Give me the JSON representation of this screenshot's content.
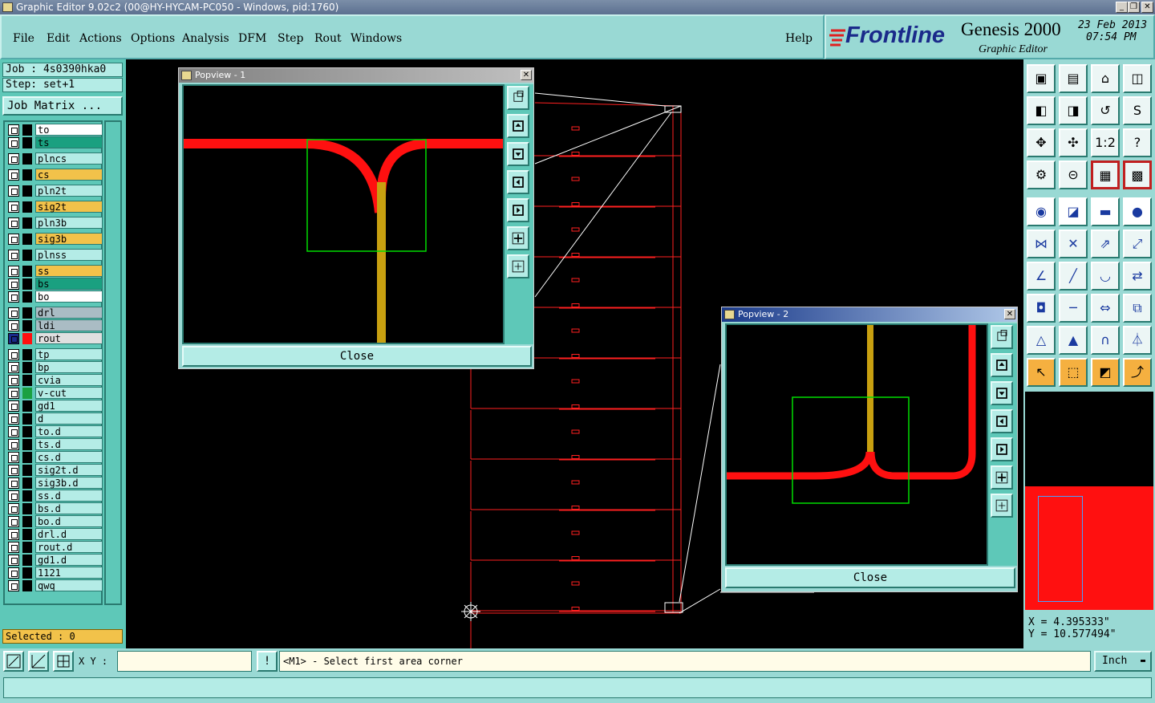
{
  "window": {
    "title": "Graphic Editor 9.02c2 (00@HY-HYCAM-PC050 - Windows, pid:1760)",
    "btn_min": "_",
    "btn_max": "❐",
    "btn_close": "✕"
  },
  "menu": {
    "items": [
      "File",
      "Edit",
      "Actions",
      "Options",
      "Analysis",
      "DFM",
      "Step",
      "Rout",
      "Windows"
    ],
    "help": "Help"
  },
  "brand": {
    "logo": "Frontline",
    "product": "Genesis 2000",
    "subtitle": "Graphic Editor",
    "date": "23 Feb 2013",
    "time": "07:54 PM"
  },
  "job": {
    "job_label": "Job : 4s0390hka0",
    "step_label": "Step: set+1",
    "matrix_button": "Job Matrix ..."
  },
  "layers": [
    {
      "name": "to",
      "bg": "#ffffff"
    },
    {
      "name": "ts",
      "bg": "#1aa080"
    },
    {
      "name": "plncs",
      "bg": "#b4ece6"
    },
    {
      "name": "cs",
      "bg": "#f2c24a"
    },
    {
      "name": "pln2t",
      "bg": "#b4ece6"
    },
    {
      "name": "sig2t",
      "bg": "#f2c24a"
    },
    {
      "name": "pln3b",
      "bg": "#b4ece6"
    },
    {
      "name": "sig3b",
      "bg": "#f2c24a"
    },
    {
      "name": "plnss",
      "bg": "#b4ece6"
    },
    {
      "name": "ss",
      "bg": "#f2c24a"
    },
    {
      "name": "bs",
      "bg": "#1aa080"
    },
    {
      "name": "bo",
      "bg": "#ffffff"
    },
    {
      "name": "drl",
      "bg": "#aabcc4"
    },
    {
      "name": "ldi",
      "bg": "#aabcc4"
    },
    {
      "name": "rout",
      "bg": "#e0e0e0"
    },
    {
      "name": "tp",
      "bg": "#b4ece6"
    },
    {
      "name": "bp",
      "bg": "#b4ece6"
    },
    {
      "name": "cvia",
      "bg": "#b4ece6"
    },
    {
      "name": "v-cut",
      "bg": "#b4ece6"
    },
    {
      "name": "gd1",
      "bg": "#b4ece6"
    },
    {
      "name": "d",
      "bg": "#b4ece6"
    },
    {
      "name": "to.d",
      "bg": "#b4ece6"
    },
    {
      "name": "ts.d",
      "bg": "#b4ece6"
    },
    {
      "name": "cs.d",
      "bg": "#b4ece6"
    },
    {
      "name": "sig2t.d",
      "bg": "#b4ece6"
    },
    {
      "name": "sig3b.d",
      "bg": "#b4ece6"
    },
    {
      "name": "ss.d",
      "bg": "#b4ece6"
    },
    {
      "name": "bs.d",
      "bg": "#b4ece6"
    },
    {
      "name": "bo.d",
      "bg": "#b4ece6"
    },
    {
      "name": "drl.d",
      "bg": "#b4ece6"
    },
    {
      "name": "rout.d",
      "bg": "#b4ece6"
    },
    {
      "name": "gd1.d",
      "bg": "#b4ece6"
    },
    {
      "name": "1121",
      "bg": "#b4ece6"
    },
    {
      "name": "qwq",
      "bg": "#b4ece6"
    }
  ],
  "selected": "Selected : 0",
  "popview1": {
    "title": "Popview - 1",
    "close_label": "Close",
    "close_x": "✕"
  },
  "popview2": {
    "title": "Popview - 2",
    "close_label": "Close",
    "close_x": "✕"
  },
  "bottom": {
    "xy_label": "X Y :",
    "xy_value": "",
    "bang": "!",
    "prompt": "<M1> - Select first area corner",
    "unit": "Inch"
  },
  "coords": {
    "x": "X = 4.395333\"",
    "y": "Y = 10.577494\""
  },
  "colors": {
    "teal": "#99d9d4",
    "trace": "#ff1010",
    "gold": "#c8a010",
    "window": "#00dd00"
  }
}
